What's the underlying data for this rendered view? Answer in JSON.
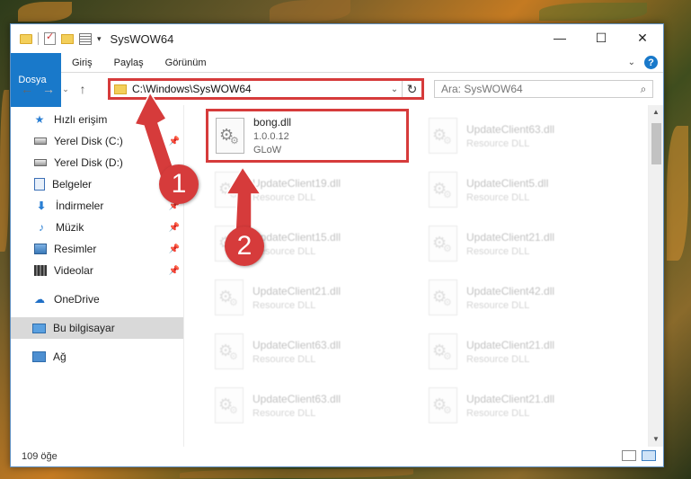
{
  "window": {
    "title": "SysWOW64",
    "controls": {
      "minimize": "—",
      "maximize": "☐",
      "close": "✕"
    }
  },
  "ribbon": {
    "tabs": [
      "Dosya",
      "Giriş",
      "Paylaş",
      "Görünüm"
    ],
    "help": "?"
  },
  "nav": {
    "back": "←",
    "forward": "→",
    "recent": "⌄",
    "up": "↑",
    "address": "C:\\Windows\\SysWOW64",
    "refresh": "↻",
    "search_placeholder": "Ara: SysWOW64",
    "search_icon": "⌕"
  },
  "sidebar": {
    "quick_access": "Hızlı erişim",
    "items": [
      {
        "label": "Yerel Disk (C:)",
        "icon": "disk-icon",
        "pinned": true
      },
      {
        "label": "Yerel Disk (D:)",
        "icon": "disk-icon",
        "pinned": false
      },
      {
        "label": "Belgeler",
        "icon": "documents-icon",
        "pinned": false
      },
      {
        "label": "İndirmeler",
        "icon": "download-icon",
        "pinned": true
      },
      {
        "label": "Müzik",
        "icon": "music-icon",
        "pinned": true
      },
      {
        "label": "Resimler",
        "icon": "pictures-icon",
        "pinned": true
      },
      {
        "label": "Videolar",
        "icon": "videos-icon",
        "pinned": true
      }
    ],
    "onedrive": "OneDrive",
    "this_pc": "Bu bilgisayar",
    "network": "Ağ"
  },
  "files": {
    "col1": [
      {
        "name": "bong.dll",
        "line2": "1.0.0.12",
        "line3": "GLoW"
      },
      {
        "name": "UpdateClient19.dll",
        "line2": "Resource DLL"
      },
      {
        "name": "UpdateClient15.dll",
        "line2": "Resource DLL"
      },
      {
        "name": "UpdateClient21.dll",
        "line2": "Resource DLL"
      },
      {
        "name": "UpdateClient63.dll",
        "line2": "Resource DLL"
      },
      {
        "name": "UpdateClient63.dll",
        "line2": "Resource DLL"
      }
    ],
    "col2": [
      {
        "name": "UpdateClient63.dll",
        "line2": "Resource DLL"
      },
      {
        "name": "UpdateClient5.dll",
        "line2": "Resource DLL"
      },
      {
        "name": "UpdateClient21.dll",
        "line2": "Resource DLL"
      },
      {
        "name": "UpdateClient42.dll",
        "line2": "Resource DLL"
      },
      {
        "name": "UpdateClient21.dll",
        "line2": "Resource DLL"
      },
      {
        "name": "UpdateClient21.dll",
        "line2": "Resource DLL"
      }
    ]
  },
  "status": {
    "count": "109 öğe"
  },
  "annotations": {
    "badge1": "1",
    "badge2": "2"
  },
  "colors": {
    "accent": "#1979ca",
    "annotation": "#d63b3b"
  }
}
